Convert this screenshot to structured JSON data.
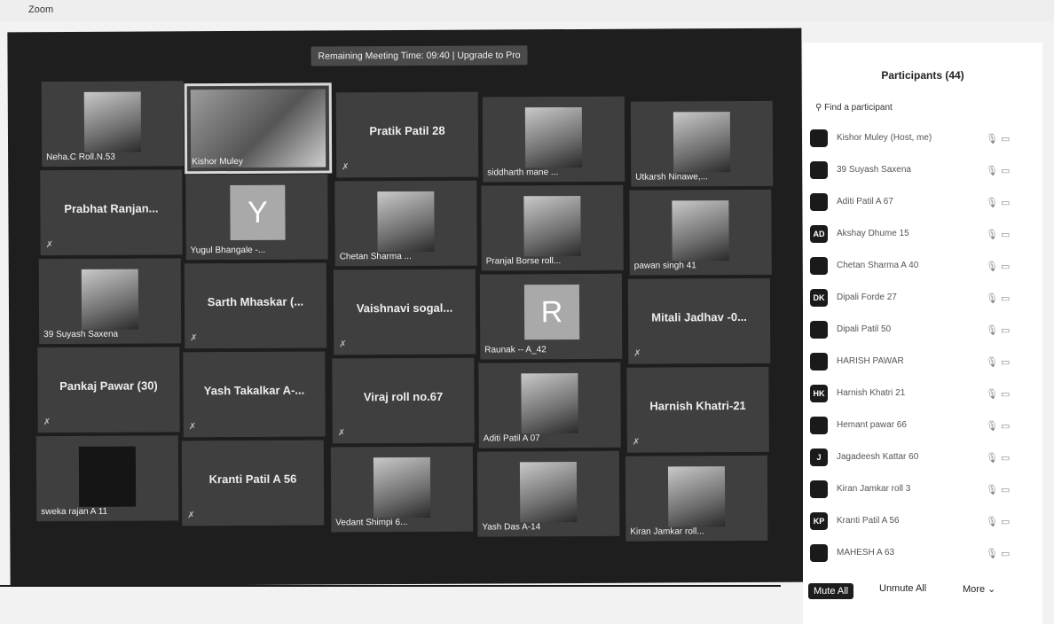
{
  "window": {
    "app_title": "Zoom",
    "controls": [
      "–",
      "□",
      "X"
    ]
  },
  "banner": "Remaining Meeting Time: 09:40 | Upgrade to Pro",
  "tiles": [
    {
      "label": "Neha.C Roll.N.53"
    },
    {
      "label": "Kishor Muley"
    },
    {
      "name": "Pratik Patil 28"
    },
    {
      "label": "siddharth mane ..."
    },
    {
      "label": "Utkarsh Ninawe,..."
    },
    {
      "name": "Prabhat Ranjan..."
    },
    {
      "label": "Yugul Bhangale -...",
      "letter": "Y"
    },
    {
      "label": "Chetan Sharma ..."
    },
    {
      "label": "Pranjal Borse roll..."
    },
    {
      "label": "pawan singh 41"
    },
    {
      "label": "39 Suyash Saxena"
    },
    {
      "name": "Sarth Mhaskar (..."
    },
    {
      "name": "Vaishnavi sogal..."
    },
    {
      "label": "Raunak -- A_42",
      "letter": "R"
    },
    {
      "name": "Mitali Jadhav -0..."
    },
    {
      "name": "Pankaj Pawar (30)"
    },
    {
      "name": "Yash Takalkar A-..."
    },
    {
      "name": "Viraj roll no.67"
    },
    {
      "label": "Aditi Patil A 07"
    },
    {
      "name": "Harnish Khatri-21"
    },
    {
      "label": "sweka rajan A 11"
    },
    {
      "name": "Kranti Patil A 56"
    },
    {
      "label": "Vedant Shimpi 6..."
    },
    {
      "label": "Yash Das A-14"
    },
    {
      "label": "Kiran Jamkar roll..."
    }
  ],
  "participants": {
    "title": "Participants (44)",
    "search_placeholder": "Find a participant",
    "list": [
      {
        "name": "Kishor Muley (Host, me)",
        "avatar": "",
        "icons": "🎙 ▭"
      },
      {
        "name": "39 Suyash Saxena",
        "avatar": "",
        "icons": "🎙 ▭"
      },
      {
        "name": "Aditi Patil A 67",
        "avatar": "",
        "icons": "🎙 ▭"
      },
      {
        "name": "Akshay Dhume 15",
        "avatar": "AD",
        "icons": "🎙 ▭"
      },
      {
        "name": "Chetan Sharma A 40",
        "avatar": "",
        "icons": "🎙 ▭"
      },
      {
        "name": "Dipali Forde 27",
        "avatar": "DK",
        "icons": "🎙 ▭"
      },
      {
        "name": "Dipali Patil 50",
        "avatar": "",
        "icons": "🎙 ▭"
      },
      {
        "name": "HARISH PAWAR",
        "avatar": "",
        "icons": "🎙 ▭"
      },
      {
        "name": "Harnish Khatri 21",
        "avatar": "HK",
        "icons": "🎙 ▭"
      },
      {
        "name": "Hemant pawar 66",
        "avatar": "",
        "icons": "🎙 ▭"
      },
      {
        "name": "Jagadeesh Kattar 60",
        "avatar": "J",
        "icons": "🎙 ▭"
      },
      {
        "name": "Kiran Jamkar roll 3",
        "avatar": "",
        "icons": "🎙 ▭"
      },
      {
        "name": "Kranti Patil A 56",
        "avatar": "KP",
        "icons": "🎙 ▭"
      },
      {
        "name": "MAHESH A 63",
        "avatar": "",
        "icons": "🎙 ▭"
      }
    ],
    "footer": {
      "mute_all": "Mute All",
      "unmute_all": "Unmute All",
      "more": "More ⌄"
    }
  }
}
